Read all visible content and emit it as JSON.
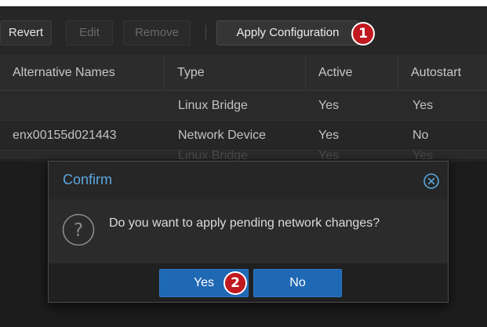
{
  "toolbar": {
    "revert_label": "Revert",
    "edit_label": "Edit",
    "remove_label": "Remove",
    "apply_label": "Apply Configuration",
    "apply_badge": "1"
  },
  "grid": {
    "columns": [
      "Alternative Names",
      "Type",
      "Active",
      "Autostart"
    ],
    "rows": [
      [
        "",
        "Linux Bridge",
        "Yes",
        "Yes"
      ],
      [
        "enx00155d021443",
        "Network Device",
        "Yes",
        "No"
      ],
      [
        "",
        "Linux Bridge",
        "Yes",
        "Yes"
      ]
    ]
  },
  "dialog": {
    "title": "Confirm",
    "message": "Do you want to apply pending network changes?",
    "question_glyph": "?",
    "yes_label": "Yes",
    "yes_badge": "2",
    "no_label": "No",
    "accent_color": "#5aa7de",
    "button_color": "#1f68b4",
    "badge_color": "#c0191f"
  },
  "icons": [
    "question-icon",
    "close-circle-icon"
  ]
}
